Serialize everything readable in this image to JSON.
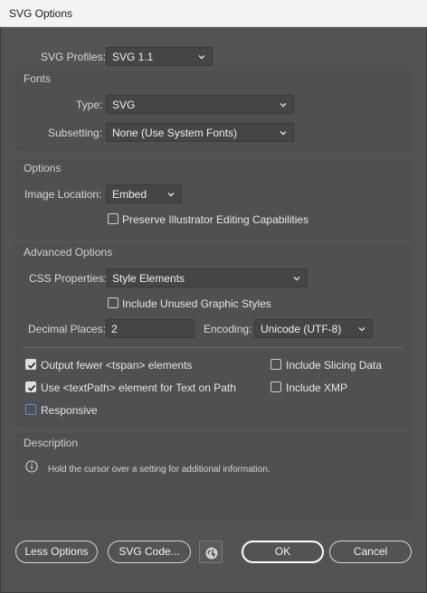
{
  "window": {
    "title": "SVG Options"
  },
  "profiles": {
    "label": "SVG Profiles:",
    "value": "SVG 1.1"
  },
  "fonts": {
    "title": "Fonts",
    "type_label": "Type:",
    "type_value": "SVG",
    "subsetting_label": "Subsetting:",
    "subsetting_value": "None (Use System Fonts)"
  },
  "options": {
    "title": "Options",
    "image_location_label": "Image Location:",
    "image_location_value": "Embed",
    "preserve_label": "Preserve Illustrator Editing Capabilities",
    "preserve_checked": false
  },
  "advanced": {
    "title": "Advanced Options",
    "css_label": "CSS Properties:",
    "css_value": "Style Elements",
    "unused_styles_label": "Include Unused Graphic Styles",
    "unused_styles_checked": false,
    "decimal_label": "Decimal Places:",
    "decimal_value": "2",
    "encoding_label": "Encoding:",
    "encoding_value": "Unicode (UTF-8)",
    "fewer_tspan_label": "Output fewer <tspan> elements",
    "fewer_tspan_checked": true,
    "textpath_label": "Use <textPath> element for Text on Path",
    "textpath_checked": true,
    "responsive_label": "Responsive",
    "responsive_checked": false,
    "slicing_label": "Include Slicing Data",
    "slicing_checked": false,
    "xmp_label": "Include XMP",
    "xmp_checked": false
  },
  "description": {
    "title": "Description",
    "text": "Hold the cursor over a setting for additional information."
  },
  "buttons": {
    "less_options": "Less Options",
    "svg_code": "SVG Code...",
    "ok": "OK",
    "cancel": "Cancel"
  },
  "icons": {
    "info": "info-icon",
    "globe": "globe-icon",
    "dropdown": "chevron-down-icon",
    "check": "check-icon"
  }
}
